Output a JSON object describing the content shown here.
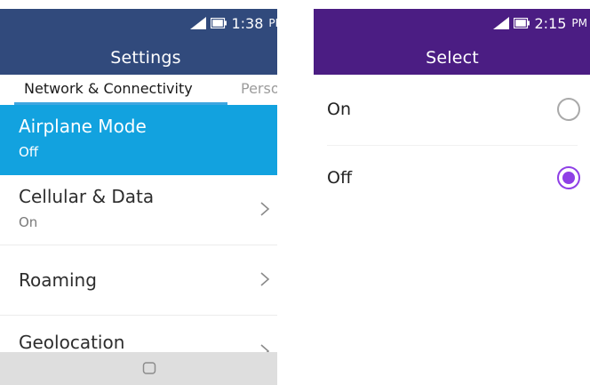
{
  "left_screen": {
    "status": {
      "time": "1:38",
      "ampm": "PM",
      "icons": [
        "signal-icon",
        "battery-icon"
      ]
    },
    "title": "Settings",
    "tabs": [
      {
        "label": "Network & Connectivity",
        "active": true
      },
      {
        "label": "Person",
        "active": false
      }
    ],
    "items": [
      {
        "label": "Airplane Mode",
        "sub": "Off",
        "selected": true
      },
      {
        "label": "Cellular & Data",
        "sub": "On"
      },
      {
        "label": "Roaming"
      },
      {
        "label": "Geolocation"
      }
    ],
    "colors": {
      "header": "#314a7c",
      "selected": "#12a2df",
      "tab_underline": "#3ea6e0",
      "bottom_bar": "#dedede"
    }
  },
  "right_screen": {
    "status": {
      "time": "2:15",
      "ampm": "PM",
      "icons": [
        "signal-icon",
        "battery-icon"
      ]
    },
    "title": "Select",
    "options": [
      {
        "label": "On",
        "checked": false
      },
      {
        "label": "Off",
        "checked": true
      }
    ],
    "colors": {
      "header": "#4b1d83",
      "radio_checked": "#8e3fe6"
    }
  }
}
